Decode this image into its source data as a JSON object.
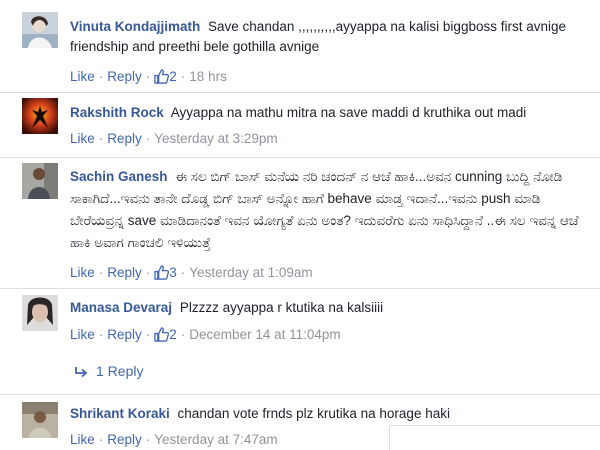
{
  "actions": {
    "like": "Like",
    "reply": "Reply",
    "dot": "·"
  },
  "comments": [
    {
      "author": "Vinuta Kondajjimath",
      "text": "Save chandan ,,,,,,,,,,ayyappa na kalisi biggboss first avnige friendship and preethi bele gothilla avnige",
      "likes": "2",
      "time": "18 hrs"
    },
    {
      "author": "Rakshith Rock",
      "text": "Ayyappa na mathu mitra na save maddi d kruthika out madi",
      "likes": "",
      "time": "Yesterday at 3:29pm"
    },
    {
      "author": "Sachin Ganesh",
      "text": "ಈ ಸಲ ಬಿಗ್ ಬಾಸ್ ಮನೆಯ ನರಿ ಚಂದನ್ ನ ಆಚೆ ಹಾಕಿ...ಅವನ cunning ಬುದ್ದಿ ನೋಡಿ ಸಾಕಾಗಿದೆ...ಇವನು ತಾನೇ ದೊಡ್ಡ ಬಿಗ್ ಬಾಸ್ ಅನ್ನೋ ಹಾಗೆ behave ಮಾಡ್ತ ಇದಾನೆ...ಇವನು push ಮಾಡಿ ಬೇರೆಯವ್ರನ್ನ save ಮಾಡಿದಾನಂತೆ ಇವನ ಯೋಗ್ಯತೆ ಏನು ಅಂತ? ಇದುವರೆಗು ಏನು ಸಾಧಿಸಿದ್ದಾನೆ ..ಈ ಸಲ ಇವನ್ನ ಆಚೆ ಹಾಕಿ ಅವಾಗ ಗಾಂಚಲಿ ಇಳಿಯುತ್ತೆ",
      "likes": "3",
      "time": "Yesterday at 1:09am"
    },
    {
      "author": "Manasa Devaraj",
      "text": "Plzzzz ayyappa r ktutika na kalsiiii",
      "likes": "2",
      "time": "December 14 at 11:04pm",
      "replies": "1 Reply"
    },
    {
      "author": "Shrikant Koraki",
      "text": "chandan vote frnds plz krutika na horage haki",
      "likes": "",
      "time": "Yesterday at 7:47am"
    }
  ]
}
